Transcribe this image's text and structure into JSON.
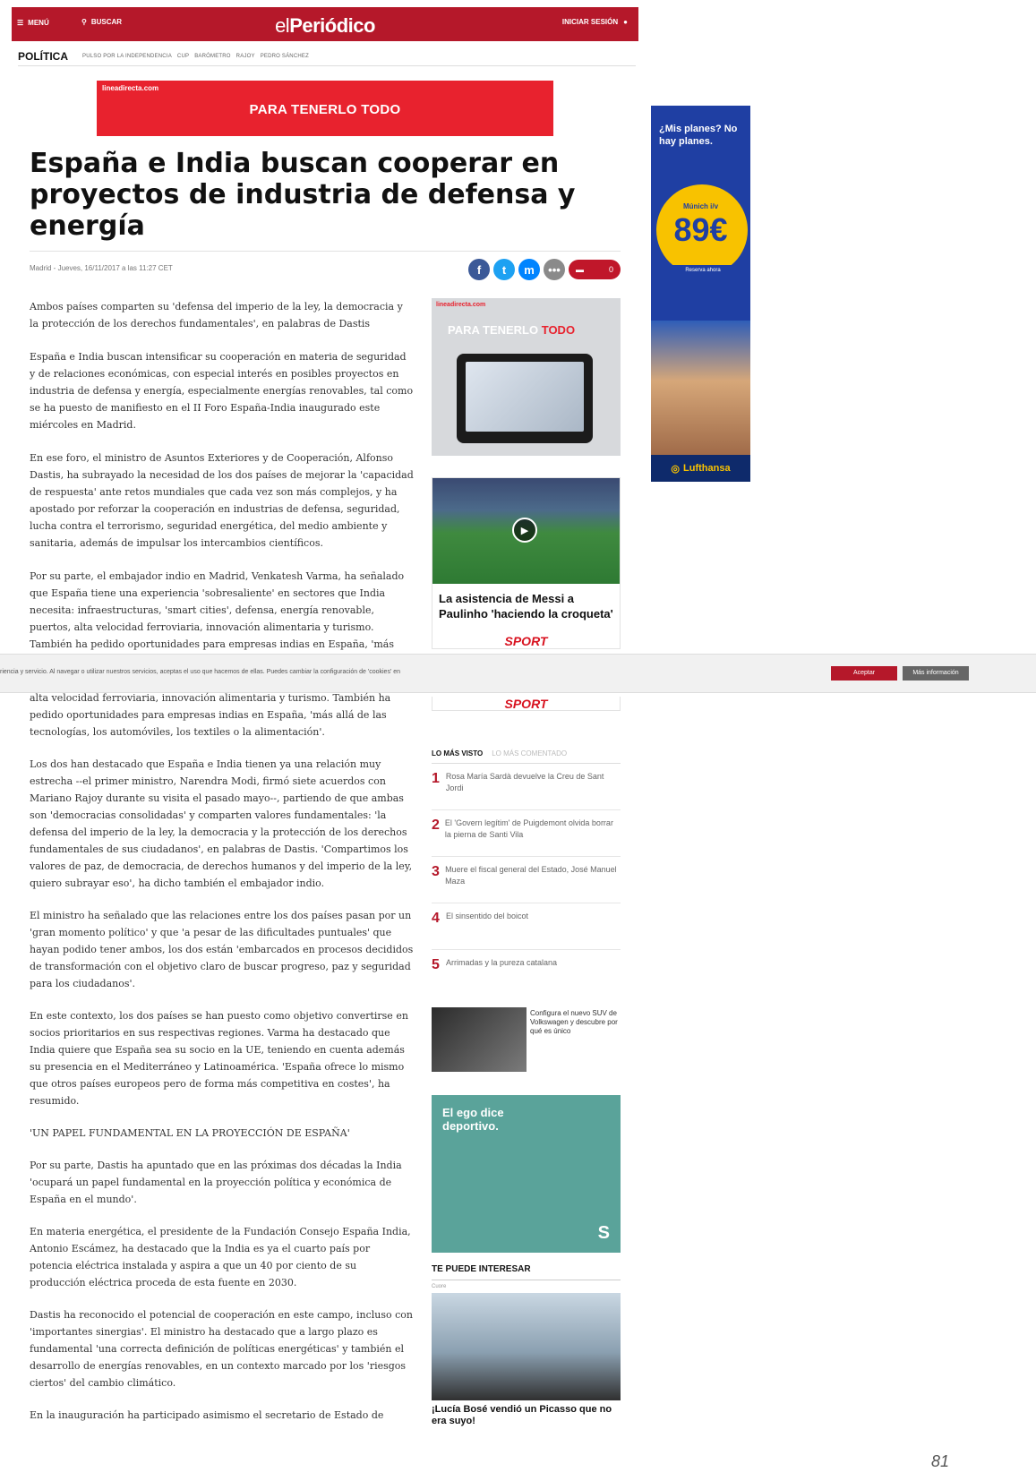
{
  "header": {
    "menu": "MENÚ",
    "search": "BUSCAR",
    "logo_a": "el",
    "logo_b": "Periódico",
    "login": "INICIAR SESIÓN"
  },
  "section": {
    "name": "POLÍTICA",
    "subs": [
      "PULSO POR LA INDEPENDENCIA",
      "CUP",
      "BARÓMETRO",
      "RAJOY",
      "PEDRO SÁNCHEZ"
    ]
  },
  "ads": {
    "top_brand": "lineadirecta.com",
    "top_claim": "PARA TENERLO TODO",
    "side_q": "¿Mis planes? No hay planes.",
    "side_city": "Múnich i/v",
    "side_price": "89€",
    "side_btn": "Reserva ahora",
    "side_brand": "Lufthansa",
    "mid_brand": "lineadirecta.com",
    "mid_claim_a": "PARA TENERLO ",
    "mid_claim_b": "TODO",
    "seat_text": "El ego dice deportivo.",
    "seat_logo": "S"
  },
  "article": {
    "title": "España e India buscan cooperar en proyectos de industria de defensa y energía",
    "meta": "Madrid - Jueves, 16/11/2017 a las 11:27 CET",
    "comments": "0",
    "p1": "Ambos países comparten su 'defensa del imperio de la ley, la democracia y la protección de los derechos fundamentales', en palabras de Dastis",
    "p2": "España e India buscan intensificar su cooperación en materia de seguridad y de relaciones económicas, con especial interés en posibles proyectos en industria de defensa y energía, especialmente energías renovables, tal como se ha puesto de manifiesto en el II Foro España-India inaugurado este miércoles en Madrid.",
    "p3": "En ese foro, el ministro de Asuntos Exteriores y de Cooperación, Alfonso Dastis, ha subrayado la necesidad de los dos países de mejorar la 'capacidad de respuesta' ante retos mundiales que cada vez son más complejos, y ha apostado por reforzar la cooperación en industrias de defensa, seguridad, lucha contra el terrorismo, seguridad energética, del medio ambiente y sanitaria, además de impulsar los intercambios científicos.",
    "p4": "Por su parte, el embajador indio en Madrid, Venkatesh Varma, ha señalado que España tiene una experiencia 'sobresaliente' en sectores que India necesita: infraestructuras, 'smart cities', defensa, energía renovable, puertos, alta velocidad ferroviaria, innovación alimentaria y turismo. También ha pedido oportunidades para empresas indias en España, 'más allá de las",
    "p4b": "alta velocidad ferroviaria, innovación alimentaria y turismo. También ha pedido oportunidades para empresas indias en España, 'más allá de las tecnologías, los automóviles, los textiles o la alimentación'.",
    "p5": "Los dos han destacado que España e India tienen ya una relación muy estrecha --el primer ministro, Narendra Modi, firmó siete acuerdos con Mariano Rajoy durante su visita el pasado mayo--, partiendo de que ambas son 'democracias consolidadas' y comparten valores fundamentales: 'la defensa del imperio de la ley, la democracia y la protección de los derechos fundamentales de sus ciudadanos', en palabras de Dastis. 'Compartimos los valores de paz, de democracia, de derechos humanos y del imperio de la ley, quiero subrayar eso', ha dicho también el embajador indio.",
    "p6": "El ministro ha señalado que las relaciones entre los dos países pasan por un 'gran momento político' y que 'a pesar de las dificultades puntuales' que hayan podido tener ambos, los dos están 'embarcados en procesos decididos de transformación con el objetivo claro de buscar progreso, paz y seguridad para los ciudadanos'.",
    "p7": "En este contexto, los dos países se han puesto como objetivo convertirse en socios prioritarios en sus respectivas regiones. Varma ha destacado que India quiere que España sea su socio en la UE, teniendo en cuenta además su presencia en el Mediterráneo y Latinoamérica. 'España ofrece lo mismo que otros países europeos pero de forma más competitiva en costes', ha resumido.",
    "p8": "'UN PAPEL FUNDAMENTAL EN LA PROYECCIÓN DE ESPAÑA'",
    "p9": "Por su parte, Dastis ha apuntado que en las próximas dos décadas la India 'ocupará un papel fundamental en la proyección política y económica de España en el mundo'.",
    "p10": "En materia energética, el presidente de la Fundación Consejo España India, Antonio Escámez, ha destacado que la India es ya el cuarto país por potencia eléctrica instalada y aspira a que un 40 por ciento de su producción eléctrica proceda de esta fuente en 2030.",
    "p11": "Dastis ha reconocido el potencial de cooperación en este campo, incluso con 'importantes sinergias'. El ministro ha destacado que a largo plazo es fundamental 'una correcta definición de políticas energéticas' y también el desarrollo de energías renovables, en un contexto marcado por los 'riesgos ciertos' del cambio climático.",
    "p12": "En la inauguración ha participado asimismo el secretario de Estado de"
  },
  "video": {
    "title": "La asistencia de Messi a Paulinho 'haciendo la croqueta'",
    "source": "SPORT"
  },
  "cookie": {
    "text": "riencia y servicio. Al navegar o utilizar nuestros servicios, aceptas el uso que hacemos de ellas. Puedes cambiar la configuración de 'cookies' en",
    "accept": "Aceptar",
    "more": "Más información"
  },
  "most": {
    "tab_on": "LO MÁS VISTO",
    "tab_off": "LO MÁS COMENTADO",
    "items": [
      {
        "n": "1",
        "t": "Rosa María Sardà devuelve la Creu de Sant Jordi"
      },
      {
        "n": "2",
        "t": "El 'Govern legítim' de Puigdemont olvida borrar la pierna de Santi Vila"
      },
      {
        "n": "3",
        "t": "Muere el fiscal general del Estado, José Manuel Maza"
      },
      {
        "n": "4",
        "t": "El sinsentido del boicot"
      },
      {
        "n": "5",
        "t": "Arrimadas y la pureza catalana"
      }
    ]
  },
  "promo": {
    "text": "Configura el nuevo SUV de Volkswagen y descubre por qué es único"
  },
  "interest": {
    "heading": "TE PUEDE INTERESAR",
    "tag": "Cuore",
    "caption": "¡Lucía Bosé vendió un Picasso que no era suyo!"
  },
  "page_number": "81",
  "colors": {
    "brand_red": "#b5182a",
    "facebook": "#3b5998",
    "twitter": "#1da1f2",
    "messenger": "#0084ff"
  }
}
